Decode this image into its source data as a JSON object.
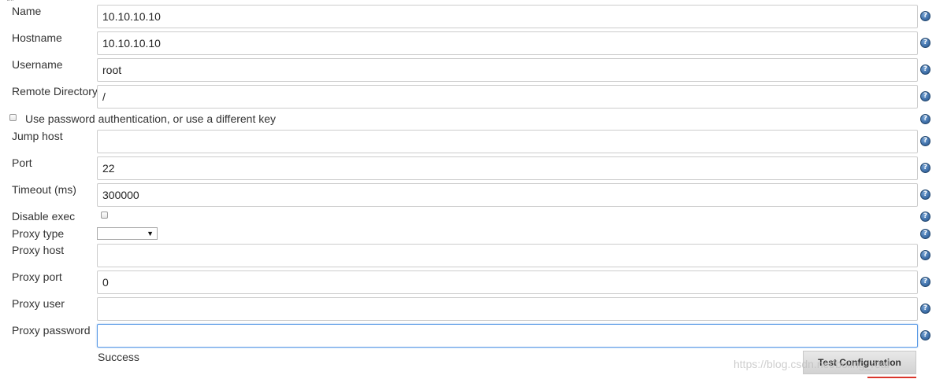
{
  "form": {
    "name": {
      "label": "Name",
      "value": "10.10.10.10"
    },
    "hostname": {
      "label": "Hostname",
      "value": "10.10.10.10"
    },
    "username": {
      "label": "Username",
      "value": "root"
    },
    "remote_directory": {
      "label": "Remote Directory",
      "value": "/"
    },
    "use_password_auth": {
      "label": "Use password authentication, or use a different key",
      "checked": false
    },
    "jump_host": {
      "label": "Jump host",
      "value": ""
    },
    "port": {
      "label": "Port",
      "value": "22"
    },
    "timeout": {
      "label": "Timeout (ms)",
      "value": "300000"
    },
    "disable_exec": {
      "label": "Disable exec",
      "checked": false
    },
    "proxy_type": {
      "label": "Proxy type",
      "selected": ""
    },
    "proxy_host": {
      "label": "Proxy host",
      "value": ""
    },
    "proxy_port": {
      "label": "Proxy port",
      "value": "0"
    },
    "proxy_user": {
      "label": "Proxy user",
      "value": ""
    },
    "proxy_password": {
      "label": "Proxy password",
      "value": ""
    }
  },
  "help_icon_glyph": "?",
  "select_arrow_glyph": "▼",
  "status": {
    "text": "Success"
  },
  "actions": {
    "test_configuration_label": "Test Configuration"
  },
  "watermark": {
    "text": "https://blog.csdn.net/boling_real"
  },
  "colors": {
    "input_border": "#cccccc",
    "focus_border": "#5b9be6",
    "help_icon": "#3e6fa8",
    "underline_accent": "#d9362c"
  }
}
